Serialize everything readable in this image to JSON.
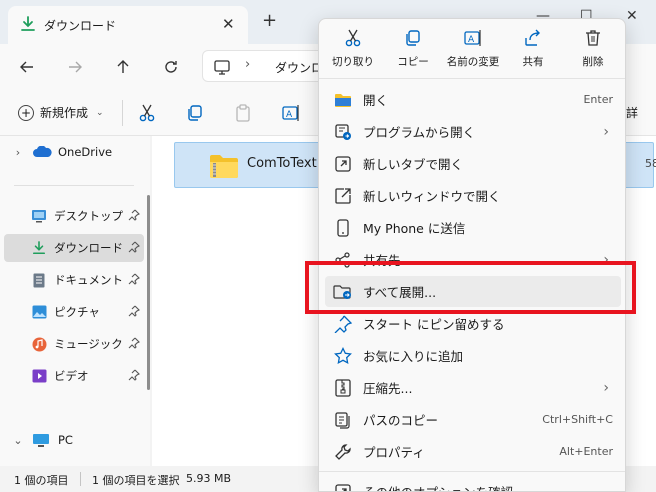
{
  "tab": {
    "title": "ダウンロード",
    "close": "✕",
    "new": "+"
  },
  "window_controls": {
    "minimize": "—",
    "maximize": "☐",
    "close": "✕"
  },
  "address": {
    "separator": "›",
    "path": "ダウンロ"
  },
  "toolbar": {
    "new_label": "新規作成",
    "right_label": "詳"
  },
  "sidebar": {
    "onedrive": "OneDrive",
    "items": [
      {
        "label": "デスクトップ",
        "icon": "desktop-icon"
      },
      {
        "label": "ダウンロード",
        "icon": "download-icon"
      },
      {
        "label": "ドキュメント",
        "icon": "document-icon"
      },
      {
        "label": "ピクチャ",
        "icon": "pictures-icon"
      },
      {
        "label": "ミュージック",
        "icon": "music-icon"
      },
      {
        "label": "ビデオ",
        "icon": "video-icon"
      }
    ],
    "pc": "PC"
  },
  "file": {
    "name": "ComToText",
    "meta": "58"
  },
  "status": {
    "items_count": "1 個の項目",
    "selection": "1 個の項目を選択",
    "size": "5.93 MB"
  },
  "context_menu": {
    "quick_actions": [
      {
        "label": "切り取り",
        "icon": "scissors-icon"
      },
      {
        "label": "コピー",
        "icon": "copy-icon"
      },
      {
        "label": "名前の変更",
        "icon": "rename-icon"
      },
      {
        "label": "共有",
        "icon": "share-icon"
      },
      {
        "label": "削除",
        "icon": "trash-icon"
      }
    ],
    "items": [
      {
        "label": "開く",
        "accel": "Enter"
      },
      {
        "label": "プログラムから開く",
        "submenu": "›"
      },
      {
        "label": "新しいタブで開く"
      },
      {
        "label": "新しいウィンドウで開く"
      },
      {
        "label": "My Phone に送信"
      },
      {
        "label": "共有先",
        "submenu": "›"
      },
      {
        "label": "すべて展開..."
      },
      {
        "label": "スタート にピン留めする"
      },
      {
        "label": "お気に入りに追加"
      },
      {
        "label": "圧縮先...",
        "submenu": "›"
      },
      {
        "label": "パスのコピー",
        "accel": "Ctrl+Shift+C"
      },
      {
        "label": "プロパティ",
        "accel": "Alt+Enter"
      },
      {
        "label": "その他のオプションを確認"
      }
    ]
  },
  "colors": {
    "highlight": "#e8141f",
    "selection": "#cfe4f7",
    "accent": "#0067c0"
  }
}
